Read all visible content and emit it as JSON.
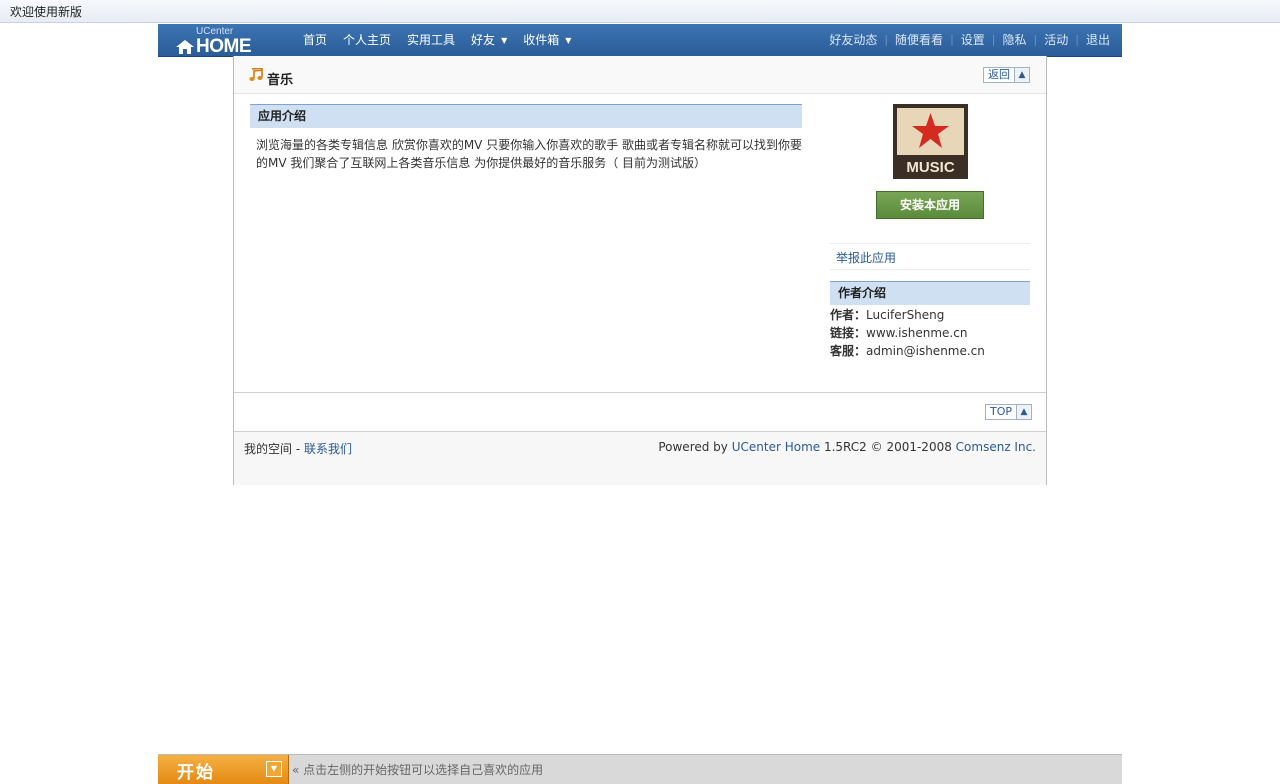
{
  "topbar": {
    "welcome": "欢迎使用新版"
  },
  "header": {
    "logo_small": "UCenter",
    "logo_big": "HOME",
    "nav": [
      {
        "label": "首页",
        "caret": ""
      },
      {
        "label": "个人主页",
        "caret": ""
      },
      {
        "label": "实用工具",
        "caret": ""
      },
      {
        "label": "好友",
        "caret": "▼"
      },
      {
        "label": "收件箱",
        "caret": "▼"
      }
    ],
    "right_nav": [
      "好友动态",
      "随便看看",
      "设置",
      "隐私",
      "活动",
      "退出"
    ]
  },
  "page": {
    "title": "音乐",
    "back_label": "返回",
    "intro_heading": "应用介绍",
    "intro_text": "浏览海量的各类专辑信息 欣赏你喜欢的MV 只要你输入你喜欢的歌手 歌曲或者专辑名称就可以找到你要的MV 我们聚合了互联网上各类音乐信息 为你提供最好的音乐服务（ 目前为测试版）",
    "app_icon_text": "MUSIC",
    "install_label": "安装本应用",
    "report_label": "举报此应用",
    "author_heading": "作者介绍",
    "author": {
      "label": "作者：",
      "value": "LuciferSheng"
    },
    "link": {
      "label": "链接：",
      "value": "www.ishenme.cn"
    },
    "support": {
      "label": "客服：",
      "value": "admin@ishenme.cn"
    },
    "top_label": "TOP"
  },
  "footer": {
    "my_space": "我的空间",
    "dash": " - ",
    "contact": "联系我们",
    "powered_by": "Powered by ",
    "product": "UCenter Home",
    "version": " 1.5RC2 © 2001-2008 ",
    "company": "Comsenz Inc."
  },
  "taskbar": {
    "start_label": "开始",
    "hint": "« 点击左侧的开始按钮可以选择自己喜欢的应用"
  },
  "colors": {
    "header_blue": "#2a5c98",
    "section_blue": "#cfe0f3",
    "install_green": "#5b8b3b",
    "start_orange": "#e48a14",
    "music_star": "#d42a20"
  }
}
